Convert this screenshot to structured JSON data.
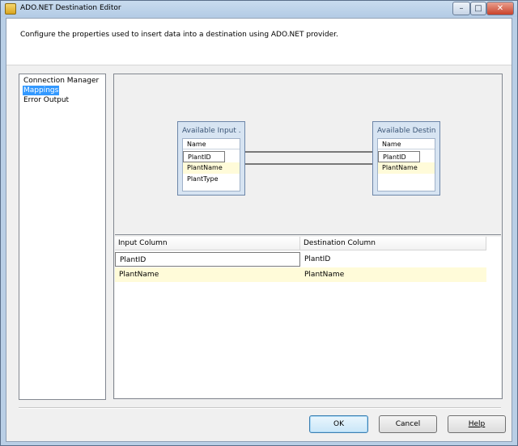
{
  "window": {
    "title": "ADO.NET Destination Editor",
    "controls": {
      "minimize": "–",
      "maximize": "□",
      "close": "✕"
    }
  },
  "header": {
    "description": "Configure the properties used to insert data into a destination using ADO.NET provider."
  },
  "nav": {
    "items": [
      {
        "label": "Connection Manager",
        "selected": false
      },
      {
        "label": "Mappings",
        "selected": true
      },
      {
        "label": "Error Output",
        "selected": false
      }
    ]
  },
  "diagram": {
    "input_table": {
      "title": "Available Input ...",
      "header": "Name",
      "columns": [
        "PlantID",
        "PlantName",
        "PlantType"
      ]
    },
    "destination_table": {
      "title": "Available Destin...",
      "header": "Name",
      "columns": [
        "PlantID",
        "PlantName"
      ]
    }
  },
  "mappings_grid": {
    "headers": [
      "Input Column",
      "Destination Column"
    ],
    "rows": [
      {
        "input": "PlantID",
        "destination": "PlantID"
      },
      {
        "input": "PlantName",
        "destination": "PlantName"
      }
    ]
  },
  "buttons": {
    "ok": "OK",
    "cancel": "Cancel",
    "help": "Help"
  },
  "colors": {
    "selection": "#3399ff",
    "highlight_row": "#fffbd9",
    "table_frame": "#d7e4f2"
  }
}
